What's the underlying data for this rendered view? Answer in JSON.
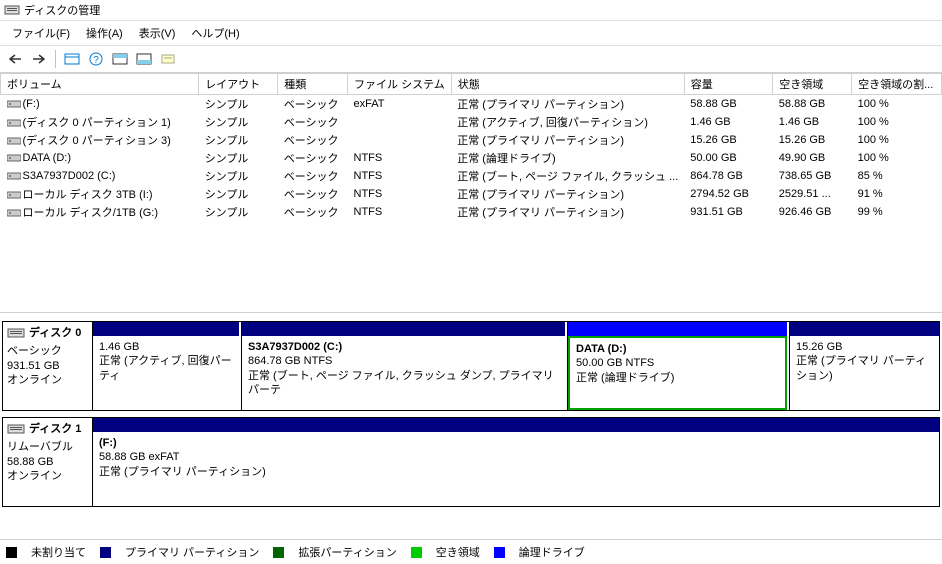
{
  "title": "ディスクの管理",
  "menu": {
    "file": "ファイル(F)",
    "action": "操作(A)",
    "view": "表示(V)",
    "help": "ヘルプ(H)"
  },
  "columns": {
    "volume": "ボリューム",
    "layout": "レイアウト",
    "type": "種類",
    "fs": "ファイル システム",
    "status": "状態",
    "capacity": "容量",
    "free": "空き領域",
    "freepct": "空き領域の割..."
  },
  "volumes": [
    {
      "name": "(F:)",
      "layout": "シンプル",
      "type": "ベーシック",
      "fs": "exFAT",
      "status": "正常 (プライマリ パーティション)",
      "capacity": "58.88 GB",
      "free": "58.88 GB",
      "pct": "100 %"
    },
    {
      "name": "(ディスク 0 パーティション 1)",
      "layout": "シンプル",
      "type": "ベーシック",
      "fs": "",
      "status": "正常 (アクティブ, 回復パーティション)",
      "capacity": "1.46 GB",
      "free": "1.46 GB",
      "pct": "100 %"
    },
    {
      "name": "(ディスク 0 パーティション 3)",
      "layout": "シンプル",
      "type": "ベーシック",
      "fs": "",
      "status": "正常 (プライマリ パーティション)",
      "capacity": "15.26 GB",
      "free": "15.26 GB",
      "pct": "100 %"
    },
    {
      "name": "DATA (D:)",
      "layout": "シンプル",
      "type": "ベーシック",
      "fs": "NTFS",
      "status": "正常 (論理ドライブ)",
      "capacity": "50.00 GB",
      "free": "49.90 GB",
      "pct": "100 %"
    },
    {
      "name": "S3A7937D002 (C:)",
      "layout": "シンプル",
      "type": "ベーシック",
      "fs": "NTFS",
      "status": "正常 (ブート, ページ ファイル, クラッシュ ...",
      "capacity": "864.78 GB",
      "free": "738.65 GB",
      "pct": "85 %"
    },
    {
      "name": "ローカル ディスク  3TB (I:)",
      "layout": "シンプル",
      "type": "ベーシック",
      "fs": "NTFS",
      "status": "正常 (プライマリ パーティション)",
      "capacity": "2794.52 GB",
      "free": "2529.51 ...",
      "pct": "91 %"
    },
    {
      "name": "ローカル ディスク/1TB (G:)",
      "layout": "シンプル",
      "type": "ベーシック",
      "fs": "NTFS",
      "status": "正常 (プライマリ パーティション)",
      "capacity": "931.51 GB",
      "free": "926.46 GB",
      "pct": "99 %"
    }
  ],
  "disks": [
    {
      "label_title": "ディスク 0",
      "label_type": "ベーシック",
      "label_size": "931.51 GB",
      "label_status": "オンライン",
      "partitions": [
        {
          "name": "",
          "details": "1.46 GB",
          "status": "正常 (アクティブ, 回復パーティ",
          "kind": "primary",
          "flex": "0 0 146px",
          "selected": false
        },
        {
          "name": "S3A7937D002  (C:)",
          "details": "864.78 GB NTFS",
          "status": "正常 (ブート, ページ ファイル, クラッシュ ダンプ, プライマリ パーテ",
          "kind": "primary",
          "flex": "1 1 300px",
          "selected": false
        },
        {
          "name": "DATA  (D:)",
          "details": "50.00 GB NTFS",
          "status": "正常 (論理ドライブ)",
          "kind": "logical",
          "flex": "0 0 220px",
          "selected": true
        },
        {
          "name": "",
          "details": "15.26 GB",
          "status": "正常 (プライマリ パーティション)",
          "kind": "primary",
          "flex": "0 0 150px",
          "selected": false
        }
      ]
    },
    {
      "label_title": "ディスク 1",
      "label_type": "リムーバブル",
      "label_size": "58.88 GB",
      "label_status": "オンライン",
      "partitions": [
        {
          "name": "(F:)",
          "details": "58.88 GB exFAT",
          "status": "正常 (プライマリ パーティション)",
          "kind": "primary",
          "flex": "1 1 100%",
          "selected": false
        }
      ]
    }
  ],
  "legend": {
    "unallocated": "未割り当て",
    "primary": "プライマリ パーティション",
    "extended": "拡張パーティション",
    "free": "空き領域",
    "logical": "論理ドライブ"
  }
}
